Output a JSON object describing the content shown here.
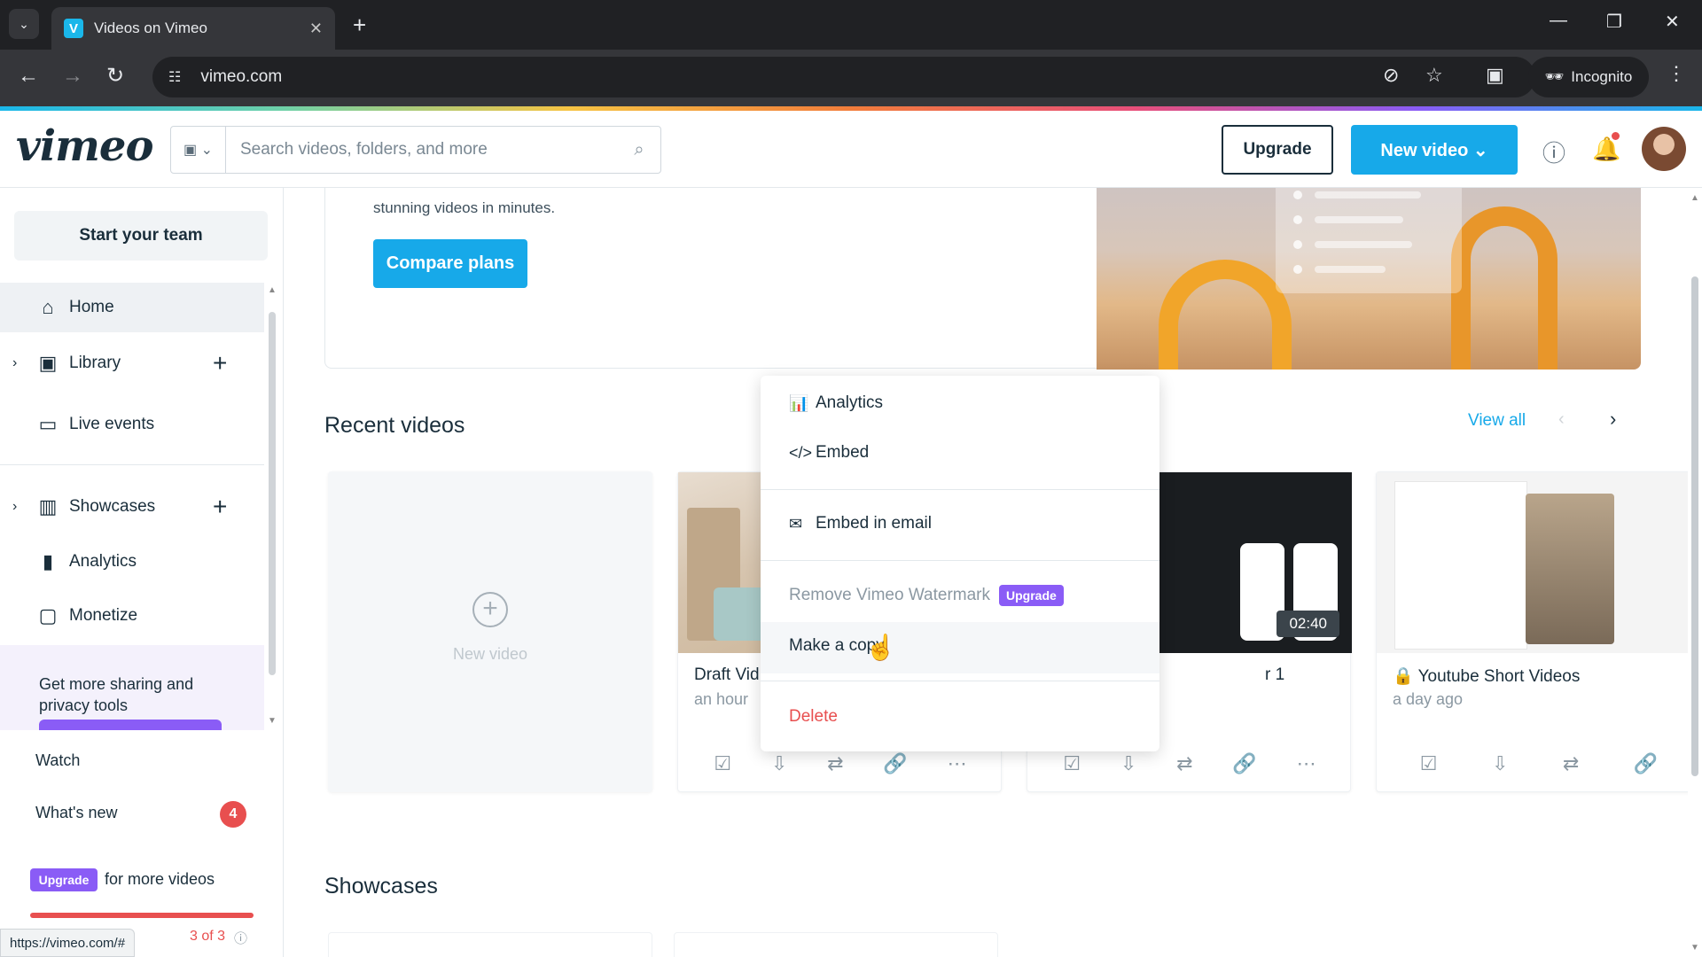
{
  "browser": {
    "tab_title": "Videos on Vimeo",
    "favicon": "V",
    "url": "vimeo.com",
    "incognito_label": "Incognito",
    "status_url": "https://vimeo.com/#"
  },
  "header": {
    "logo": "vimeo",
    "search_placeholder": "Search videos, folders, and more",
    "upgrade_label": "Upgrade",
    "new_video_label": "New video"
  },
  "sidebar": {
    "team_button": "Start your team",
    "items": [
      {
        "label": "Home",
        "icon": "home-icon",
        "active": true
      },
      {
        "label": "Library",
        "icon": "library-icon",
        "expandable": true,
        "addable": true
      },
      {
        "label": "Live events",
        "icon": "camera-icon"
      },
      {
        "label": "Showcases",
        "icon": "showcases-icon",
        "expandable": true,
        "addable": true
      },
      {
        "label": "Analytics",
        "icon": "analytics-icon"
      },
      {
        "label": "Monetize",
        "icon": "monetize-icon"
      }
    ],
    "promo_text": "Get more sharing and privacy tools",
    "watch_label": "Watch",
    "whats_new_label": "What's new",
    "whats_new_count": "4",
    "upgrade_pill": "Upgrade",
    "upgrade_text": "for more videos",
    "quota_text": "3 of 3"
  },
  "main": {
    "hero_subtitle": "stunning videos in minutes.",
    "compare_plans": "Compare plans",
    "recent_videos_title": "Recent videos",
    "view_all": "View all",
    "new_video_card": "New video",
    "videos": [
      {
        "title": "Draft Vid",
        "time": "an hour"
      },
      {
        "title": "r 1",
        "time": "",
        "duration": "02:40"
      },
      {
        "title": "Youtube Short Videos",
        "time": "a day ago",
        "private": true
      }
    ],
    "showcases_title": "Showcases"
  },
  "context_menu": {
    "analytics": "Analytics",
    "embed": "Embed",
    "embed_email": "Embed in email",
    "remove_watermark": "Remove Vimeo Watermark",
    "upgrade_tag": "Upgrade",
    "make_copy": "Make a copy",
    "delete": "Delete"
  },
  "colors": {
    "brand_blue": "#17a9e9",
    "upgrade_purple": "#8a5cf6",
    "danger_red": "#e84f4f"
  }
}
